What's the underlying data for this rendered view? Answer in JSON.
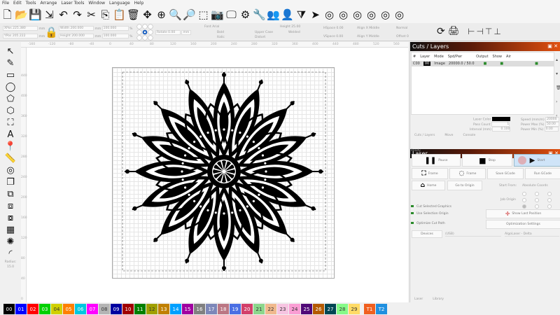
{
  "menu": [
    "File",
    "Edit",
    "Tools",
    "Arrange",
    "Laser Tools",
    "Window",
    "Language",
    "Help"
  ],
  "toolbar_icons": [
    "new-file",
    "open-folder",
    "save",
    "import",
    "undo",
    "redo",
    "cut",
    "copy",
    "paste",
    "delete",
    "move",
    "zoom-frame",
    "zoom-in",
    "zoom-out",
    "select-rect",
    "camera",
    "monitor",
    "settings-gear",
    "tools-wrench",
    "users",
    "user",
    "arrange",
    "send",
    "target",
    "target2",
    "target3",
    "target4",
    "target5",
    "target6"
  ],
  "props": {
    "xpos": "XPos 225.380",
    "ypos": "YPos 205.222",
    "width": "Width 200.000",
    "height": "Height 200.000",
    "wpct": "100.000",
    "hpct": "100.000",
    "unit": "mm",
    "pct": "%",
    "rotate": "Rotate 0.00",
    "rot_unit": "mm",
    "font": "Font Arial",
    "font_height": "Height 25.00",
    "hspace": "HSpace 0.00",
    "vspace": "VSpace 0.00",
    "align_x": "Align X Middle",
    "align_y": "Align Y Middle",
    "normal": "Normal",
    "offset": "Offset 0",
    "bold": "Bold",
    "italic": "Italic",
    "upper": "Upper Case",
    "distort": "Distort",
    "welded": "Welded"
  },
  "ruler_top": [
    "-160",
    "-120",
    "-80",
    "-40",
    "0",
    "40",
    "80",
    "120",
    "160",
    "200",
    "240",
    "280",
    "320",
    "360",
    "400",
    "440",
    "480",
    "520",
    "560"
  ],
  "ruler_left": [
    "440",
    "400",
    "360",
    "320",
    "280",
    "240",
    "200",
    "160",
    "120",
    "80",
    "40",
    "0"
  ],
  "left_tools": {
    "radius_label": "Radius:",
    "radius_value": "15.0"
  },
  "cuts": {
    "title": "Cuts / Layers",
    "columns": [
      "#",
      "Layer",
      "Mode",
      "Spd/Pwr",
      "Output",
      "Show",
      "Air"
    ],
    "rows": [
      {
        "num": "C00",
        "layer": "00",
        "mode": "Image",
        "spdpwr": "20000.0 / 50.0"
      }
    ],
    "layer_color_label": "Laser Color",
    "pass_count_label": "Pass Count",
    "pass_count": "1",
    "interval_label": "Interval (mm)",
    "interval": "0.100",
    "speed_label": "Speed (mm/m)",
    "speed": "20000",
    "pmax_label": "Power Max (%)",
    "pmax": "50.00",
    "pmin_label": "Power Min (%)",
    "pmin": "0.00",
    "tabs": [
      "Cuts / Layers",
      "Move",
      "Console"
    ]
  },
  "laser": {
    "title": "Laser",
    "ready": "Ready",
    "pause": "Pause",
    "stop": "Stop",
    "start": "Start",
    "frame1": "Frame",
    "frame2": "Frame",
    "save_gcode": "Save GCode",
    "run_gcode": "Run GCode",
    "home": "Home",
    "go_origin": "Go to Origin",
    "start_from_label": "Start From:",
    "start_from": "Absolute Coords",
    "job_origin": "Job Origin",
    "cut_selected": "Cut Selected Graphics",
    "use_selection_origin": "Use Selection Origin",
    "optimize": "Optimize Cut Path",
    "show_last": "Show Last Position",
    "opt_settings": "Optimization Settings",
    "devices": "Devices",
    "port": "(USB)",
    "device": "AlgoLaser - Delta",
    "tabs": [
      "Laser",
      "Library"
    ]
  },
  "palette": [
    [
      "00",
      "#000000"
    ],
    [
      "01",
      "#0000ff"
    ],
    [
      "02",
      "#ff0000"
    ],
    [
      "03",
      "#00d000"
    ],
    [
      "04",
      "#d0d000"
    ],
    [
      "05",
      "#ff8000"
    ],
    [
      "06",
      "#00c8e0"
    ],
    [
      "07",
      "#ff00ff"
    ],
    [
      "08",
      "#b4b4b4"
    ],
    [
      "09",
      "#0000a0"
    ],
    [
      "10",
      "#a00000"
    ],
    [
      "11",
      "#008000"
    ],
    [
      "12",
      "#a0a000"
    ],
    [
      "13",
      "#c08000"
    ],
    [
      "14",
      "#00a0ff"
    ],
    [
      "15",
      "#a000a0"
    ],
    [
      "16",
      "#808080"
    ],
    [
      "17",
      "#7d87b9"
    ],
    [
      "18",
      "#bb7784"
    ],
    [
      "19",
      "#4a6fe3"
    ],
    [
      "20",
      "#d33f6a"
    ],
    [
      "21",
      "#8cd78c"
    ],
    [
      "22",
      "#f0b98d"
    ],
    [
      "23",
      "#f6c4e1"
    ],
    [
      "24",
      "#fa9ed4"
    ],
    [
      "25",
      "#500a78"
    ],
    [
      "26",
      "#b45a00"
    ],
    [
      "27",
      "#004754"
    ],
    [
      "28",
      "#86fa88"
    ],
    [
      "29",
      "#ffdb66"
    ],
    [
      "T1",
      "#f06020"
    ],
    [
      "T2",
      "#2090e0"
    ]
  ]
}
